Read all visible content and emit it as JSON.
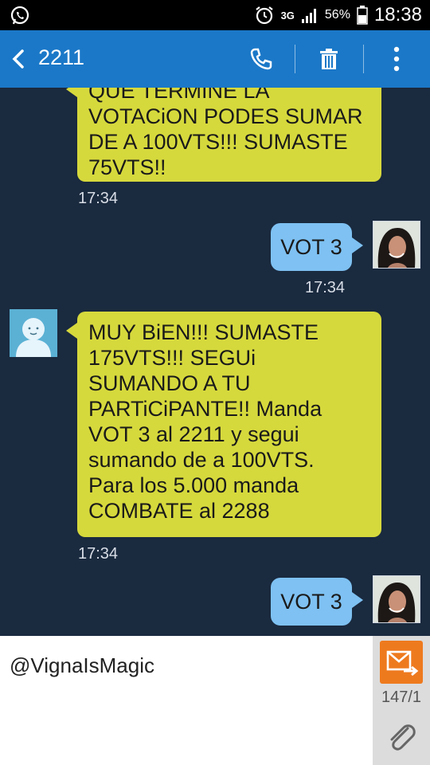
{
  "status_bar": {
    "network": "3G",
    "battery_percent": "56%",
    "time": "18:38",
    "icons": [
      "whatsapp-icon",
      "alarm-icon",
      "network-3g-icon",
      "signal-icon",
      "battery-icon"
    ]
  },
  "app_bar": {
    "title": "2211",
    "icons": [
      "back-arrow-icon",
      "phone-icon",
      "trash-icon",
      "more-vert-icon"
    ]
  },
  "conversation": {
    "messages": [
      {
        "direction": "incoming",
        "lines": [
          "QUE TERMINE LA",
          "VOTACiON PODES SUMAR",
          "DE A 100VTS!!! SUMASTE",
          "75VTS!!"
        ],
        "time": "17:34"
      },
      {
        "direction": "outgoing",
        "text": "VOT 3",
        "time": "17:34"
      },
      {
        "direction": "incoming",
        "lines": [
          "MUY BiEN!!! SUMASTE",
          "175VTS!!! SEGUi",
          "SUMANDO A TU",
          "PARTiCiPANTE!! Manda",
          "VOT 3 al 2211 y segui",
          "sumando de a 100VTS.",
          "Para los 5.000 manda",
          "COMBATE al 2288"
        ],
        "time": "17:34"
      },
      {
        "direction": "outgoing",
        "text": "VOT 3"
      }
    ]
  },
  "composer": {
    "value": "@VignaIsMagic",
    "char_counter": "147/1"
  },
  "colors": {
    "app_bar": "#1b78c8",
    "conversation_bg": "#1a2a3f",
    "incoming_bubble": "#d6d93c",
    "outgoing_bubble": "#7ec1f2",
    "send_button": "#ee7a1e"
  }
}
